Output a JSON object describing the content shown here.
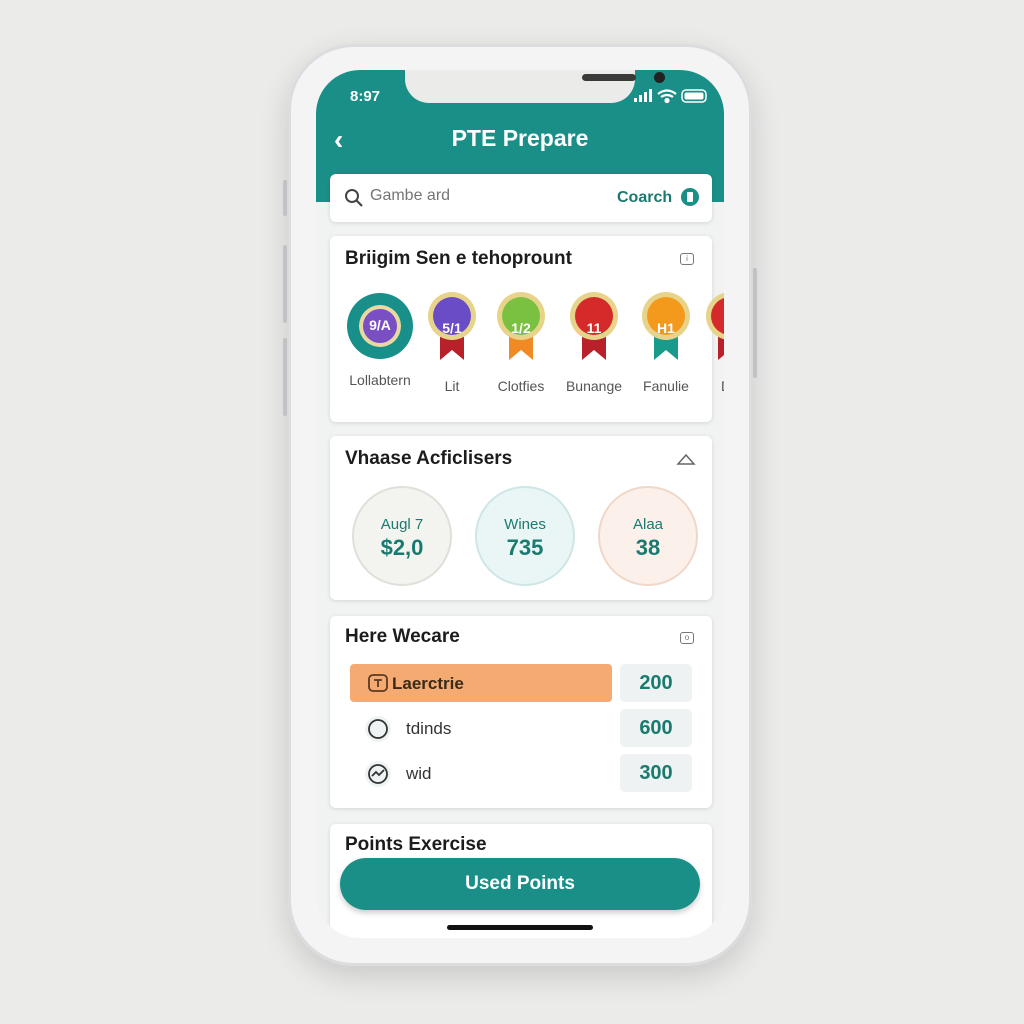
{
  "status_bar": {
    "time": "8:97"
  },
  "header": {
    "title": "PTE Prepare",
    "back_icon": "chevron-left-icon"
  },
  "search": {
    "placeholder": "Gambe ard",
    "action_label": "Coarch"
  },
  "badges_card": {
    "title": "Briigim Sen e tehoprount",
    "items": [
      {
        "label": "Lollabtern",
        "text": "9/A",
        "color": "#7b4fc4",
        "ring": "#188f88"
      },
      {
        "label": "Lit",
        "text": "5/1",
        "color": "#6a4cc6",
        "ribbon": "#b8202a"
      },
      {
        "label": "Clotfies",
        "text": "1/2",
        "color": "#7ac142",
        "ribbon": "#f08a24"
      },
      {
        "label": "Bunange",
        "text": "11",
        "color": "#d42a2a",
        "ribbon": "#b8202a"
      },
      {
        "label": "Fanulie",
        "text": "H1",
        "color": "#f39a1d",
        "ribbon": "#1a9a8a"
      },
      {
        "label": "De",
        "text": "",
        "color": "#d42a2a",
        "ribbon": "#b8202a"
      }
    ]
  },
  "stats_card": {
    "title": "Vhaase Acficlisers",
    "stats": [
      {
        "label": "Augl 7",
        "value": "$2,0",
        "bg": "#f3f3f0",
        "border": "#e0e0da"
      },
      {
        "label": "Wines",
        "value": "735",
        "bg": "#eaf5f5",
        "border": "#cfe6e6"
      },
      {
        "label": "Alaa",
        "value": "38",
        "bg": "#fbf0ea",
        "border": "#f0d8c8"
      }
    ]
  },
  "points_card": {
    "title": "Here Wecare",
    "rows": [
      {
        "label": "Laerctrie",
        "value": "200",
        "highlight": true
      },
      {
        "label": "tdinds",
        "value": "600",
        "highlight": false
      },
      {
        "label": "wid",
        "value": "300",
        "highlight": false
      }
    ]
  },
  "exercise_card": {
    "title": "Points Exercise",
    "button_label": "Used Points"
  },
  "colors": {
    "accent": "#1a8f88",
    "highlight": "#f5aa72"
  }
}
